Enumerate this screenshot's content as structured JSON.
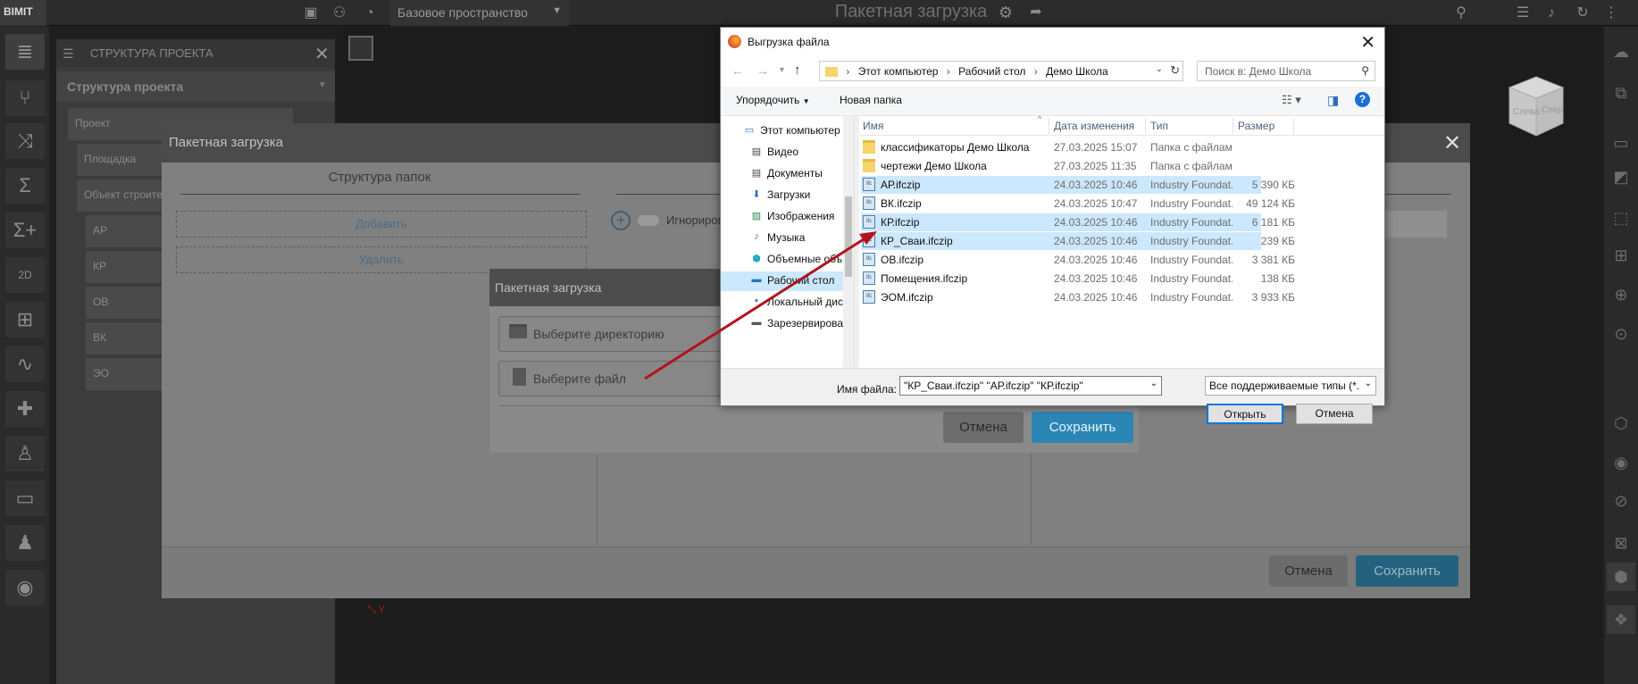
{
  "topbar": {
    "logo": "BIMIT",
    "space_select": "Базовое пространство",
    "title": "Пакетная загрузка"
  },
  "structure_panel": {
    "header": "СТРУКТУРА ПРОЕКТА",
    "subheader": "Структура проекта",
    "nodes": [
      "Проект",
      "Площадка",
      "Объект строите",
      "АР",
      "КР",
      "ОВ",
      "ВК",
      "ЭО"
    ]
  },
  "batch_modal": {
    "title": "Пакетная загрузка",
    "folders_title": "Структура папок",
    "add_label": "Добавить",
    "delete_label": "Удалить",
    "ignore_label": "Игнориров",
    "cancel_label": "Отмена",
    "save_label": "Сохранить"
  },
  "small_modal": {
    "title": "Пакетная загрузка",
    "choose_dir": "Выберите директорию",
    "choose_file": "Выберите файл",
    "cancel_label": "Отмена",
    "save_label": "Сохранить"
  },
  "file_dialog": {
    "title": "Выгрузка файла",
    "breadcrumb": [
      "Этот компьютер",
      "Рабочий стол",
      "Демо Школа"
    ],
    "search_placeholder": "Поиск в: Демо Школа",
    "organize_label": "Упорядочить",
    "new_folder_label": "Новая папка",
    "tree": [
      "Этот компьютер",
      "Видео",
      "Документы",
      "Загрузки",
      "Изображения",
      "Музыка",
      "Объемные объ",
      "Рабочий стол",
      "Локальный дис",
      "Зарезервирова"
    ],
    "columns": [
      "Имя",
      "Дата изменения",
      "Тип",
      "Размер"
    ],
    "files": [
      {
        "name": "классификаторы Демо Школа",
        "date": "27.03.2025 15:07",
        "type": "Папка с файлами",
        "size": "",
        "kind": "folder",
        "selected": false
      },
      {
        "name": "чертежи Демо Школа",
        "date": "27.03.2025 11:35",
        "type": "Папка с файлами",
        "size": "",
        "kind": "folder",
        "selected": false
      },
      {
        "name": "АР.ifczip",
        "date": "24.03.2025 10:46",
        "type": "Industry Foundat...",
        "size": "5 390 КБ",
        "kind": "ifc",
        "selected": true
      },
      {
        "name": "ВК.ifczip",
        "date": "24.03.2025 10:47",
        "type": "Industry Foundat...",
        "size": "49 124 КБ",
        "kind": "ifc",
        "selected": false
      },
      {
        "name": "КР.ifczip",
        "date": "24.03.2025 10:46",
        "type": "Industry Foundat...",
        "size": "6 181 КБ",
        "kind": "ifc",
        "selected": true
      },
      {
        "name": "КР_Сваи.ifczip",
        "date": "24.03.2025 10:46",
        "type": "Industry Foundat...",
        "size": "239 КБ",
        "kind": "ifc",
        "selected": true
      },
      {
        "name": "ОВ.ifczip",
        "date": "24.03.2025 10:46",
        "type": "Industry Foundat...",
        "size": "3 381 КБ",
        "kind": "ifc",
        "selected": false
      },
      {
        "name": "Помещения.ifczip",
        "date": "24.03.2025 10:46",
        "type": "Industry Foundat...",
        "size": "138 КБ",
        "kind": "ifc",
        "selected": false
      },
      {
        "name": "ЭОМ.ifczip",
        "date": "24.03.2025 10:46",
        "type": "Industry Foundat...",
        "size": "3 933 КБ",
        "kind": "ifc",
        "selected": false
      }
    ],
    "filename_label": "Имя файла:",
    "filename_value": "\"КР_Сваи.ifczip\" \"АР.ifczip\" \"КР.ifczip\"",
    "filetype_value": "Все поддерживаемые типы (*.",
    "open_label": "Открыть",
    "cancel_label": "Отмена",
    "ifc_badge": "ifc"
  },
  "navcube": {
    "left": "Слева",
    "front": "Спер"
  },
  "colors": {
    "accent": "#2c86b5",
    "arrow": "#b0141a",
    "selection": "#cce8ff"
  }
}
